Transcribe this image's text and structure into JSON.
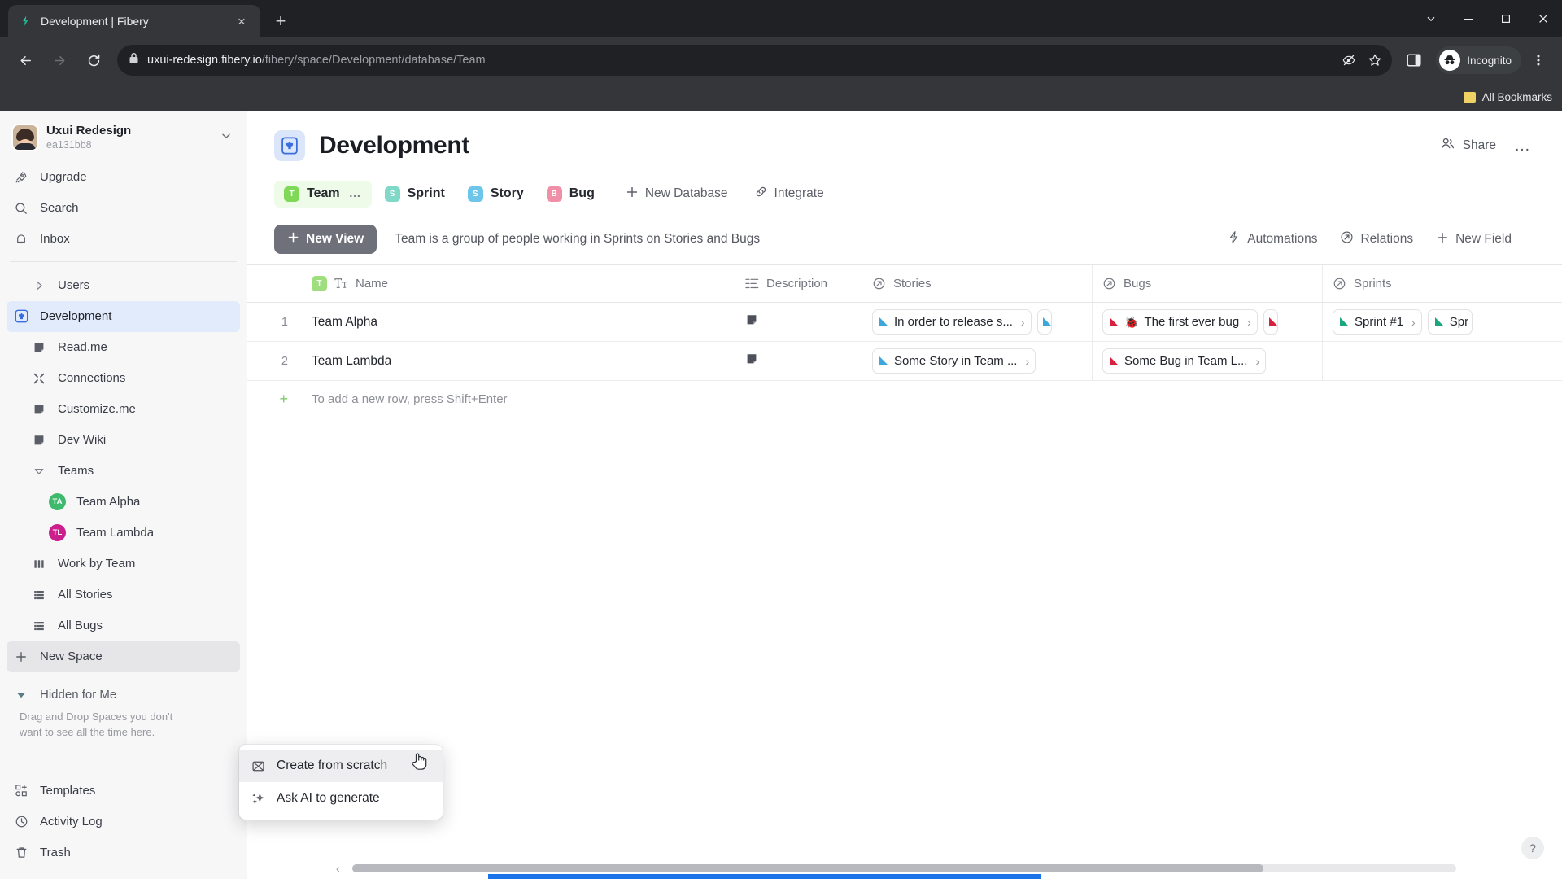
{
  "browser": {
    "tab": {
      "title": "Development | Fibery",
      "favicon": "fibery-logo-icon",
      "close": "×"
    },
    "new_tab": "+",
    "window_controls": {
      "minimize_menu": "chevron-down-icon",
      "minimize": "minimize-icon",
      "maximize": "maximize-icon",
      "close": "close-icon"
    },
    "nav": {
      "back": "back-arrow-icon",
      "forward": "forward-arrow-icon",
      "reload": "reload-icon"
    },
    "url": {
      "lock": "lock-icon",
      "domain": "uxui-redesign.fibery.io",
      "path": "/fibery/space/Development/database/Team"
    },
    "omni": {
      "tracking": "eye-slash-icon",
      "bookmark": "star-icon"
    },
    "side_panel": "side-panel-icon",
    "profile": {
      "label": "Incognito",
      "icon": "incognito-icon"
    },
    "menu": "kebab-menu-icon",
    "bookmarks": {
      "label": "All Bookmarks",
      "icon": "folder-icon"
    }
  },
  "sidebar": {
    "workspace": {
      "name": "Uxui Redesign",
      "id": "ea131bb8",
      "caret": "chevron-down-icon"
    },
    "top_items": [
      {
        "label": "Upgrade",
        "icon": "rocket-icon"
      },
      {
        "label": "Search",
        "icon": "search-icon"
      },
      {
        "label": "Inbox",
        "icon": "bell-icon"
      }
    ],
    "spaces": [
      {
        "label": "Users",
        "icon": "chevron-right-icon",
        "indent": 1,
        "state": "collapsed"
      },
      {
        "label": "Development",
        "icon": "space-icon",
        "indent": 0,
        "state": "active"
      },
      {
        "label": "Read.me",
        "icon": "document-icon",
        "indent": 1
      },
      {
        "label": "Connections",
        "icon": "connections-icon",
        "indent": 1
      },
      {
        "label": "Customize.me",
        "icon": "document-icon",
        "indent": 1
      },
      {
        "label": "Dev Wiki",
        "icon": "document-icon",
        "indent": 1
      },
      {
        "label": "Teams",
        "icon": "chevron-down-icon",
        "indent": 1,
        "state": "expanded"
      },
      {
        "label": "Team Alpha",
        "icon": "avatar-badge",
        "indent": 2,
        "badge": "TA",
        "color": "#3fba6d"
      },
      {
        "label": "Team Lambda",
        "icon": "avatar-badge",
        "indent": 2,
        "badge": "TL",
        "color": "#cc1f8e"
      },
      {
        "label": "Work by Team",
        "icon": "chart-icon",
        "indent": 1
      },
      {
        "label": "All Stories",
        "icon": "grid-icon",
        "indent": 1
      },
      {
        "label": "All Bugs",
        "icon": "grid-icon",
        "indent": 1
      }
    ],
    "new_space": {
      "label": "New Space",
      "icon": "plus-icon",
      "state": "hovered"
    },
    "hidden": {
      "label": "Hidden for Me",
      "icon": "triangle-down-icon",
      "note": "Drag and Drop Spaces you don't want to see all the time here."
    },
    "bottom_items": [
      {
        "label": "Templates",
        "icon": "templates-icon"
      },
      {
        "label": "Activity Log",
        "icon": "clock-icon"
      },
      {
        "label": "Trash",
        "icon": "trash-icon"
      }
    ]
  },
  "main": {
    "space_icon": "development-space-icon",
    "title": "Development",
    "share": {
      "label": "Share",
      "icon": "people-icon"
    },
    "more": "…",
    "databases": [
      {
        "label": "Team",
        "badge": "T",
        "color": "#7ed957",
        "active": true,
        "dots": "…"
      },
      {
        "label": "Sprint",
        "badge": "S",
        "color": "#7fd8c8",
        "active": false
      },
      {
        "label": "Story",
        "badge": "S",
        "color": "#6dc6ea",
        "active": false
      },
      {
        "label": "Bug",
        "badge": "B",
        "color": "#ef90a8",
        "active": false
      }
    ],
    "db_actions": [
      {
        "label": "New Database",
        "icon": "plus-icon"
      },
      {
        "label": "Integrate",
        "icon": "integrate-icon"
      }
    ],
    "view_bar": {
      "new_view": {
        "label": "New View",
        "icon": "plus-icon"
      },
      "description": "Team is a group of people working in Sprints on Stories and Bugs",
      "actions": [
        {
          "label": "Automations",
          "icon": "bolt-icon"
        },
        {
          "label": "Relations",
          "icon": "relation-icon"
        },
        {
          "label": "New Field",
          "icon": "plus-icon"
        }
      ]
    }
  },
  "grid": {
    "columns": [
      {
        "key": "index",
        "label": "",
        "icon": ""
      },
      {
        "key": "name",
        "label": "Name",
        "icon": "text-type-icon",
        "badge": "T"
      },
      {
        "key": "description",
        "label": "Description",
        "icon": "rich-text-icon"
      },
      {
        "key": "stories",
        "label": "Stories",
        "icon": "relation-icon"
      },
      {
        "key": "bugs",
        "label": "Bugs",
        "icon": "relation-icon"
      },
      {
        "key": "sprints",
        "label": "Sprints",
        "icon": "relation-icon"
      }
    ],
    "rows": [
      {
        "index": "1",
        "name": "Team Alpha",
        "description_icon": "document-icon",
        "stories": [
          {
            "label": "In order to release s...",
            "color": "#3da7dd",
            "arrow": "›"
          },
          {
            "label": "",
            "color": "#3da7dd",
            "partial": true
          }
        ],
        "bugs": [
          {
            "label": "The first ever bug",
            "color": "#d7213f",
            "emoji": "🐞",
            "arrow": "›"
          },
          {
            "label": "",
            "color": "#d7213f",
            "partial": true
          }
        ],
        "sprints": [
          {
            "label": "Sprint #1",
            "color": "#1aa67f",
            "arrow": "›"
          },
          {
            "label": "Spr",
            "color": "#1aa67f",
            "partial": true
          }
        ]
      },
      {
        "index": "2",
        "name": "Team Lambda",
        "description_icon": "document-icon",
        "stories": [
          {
            "label": "Some Story in Team ...",
            "color": "#3da7dd",
            "arrow": "›"
          }
        ],
        "bugs": [
          {
            "label": "Some Bug in Team L...",
            "color": "#d7213f",
            "arrow": "›"
          }
        ],
        "sprints": []
      }
    ],
    "add_row": {
      "icon": "plus-icon",
      "hint": "To add a new row, press Shift+Enter"
    },
    "help": "?"
  },
  "context_menu": {
    "items": [
      {
        "label": "Create from scratch",
        "icon": "scratch-icon",
        "highlighted": true
      },
      {
        "label": "Ask AI to generate",
        "icon": "sparkle-icon",
        "highlighted": false
      }
    ]
  }
}
